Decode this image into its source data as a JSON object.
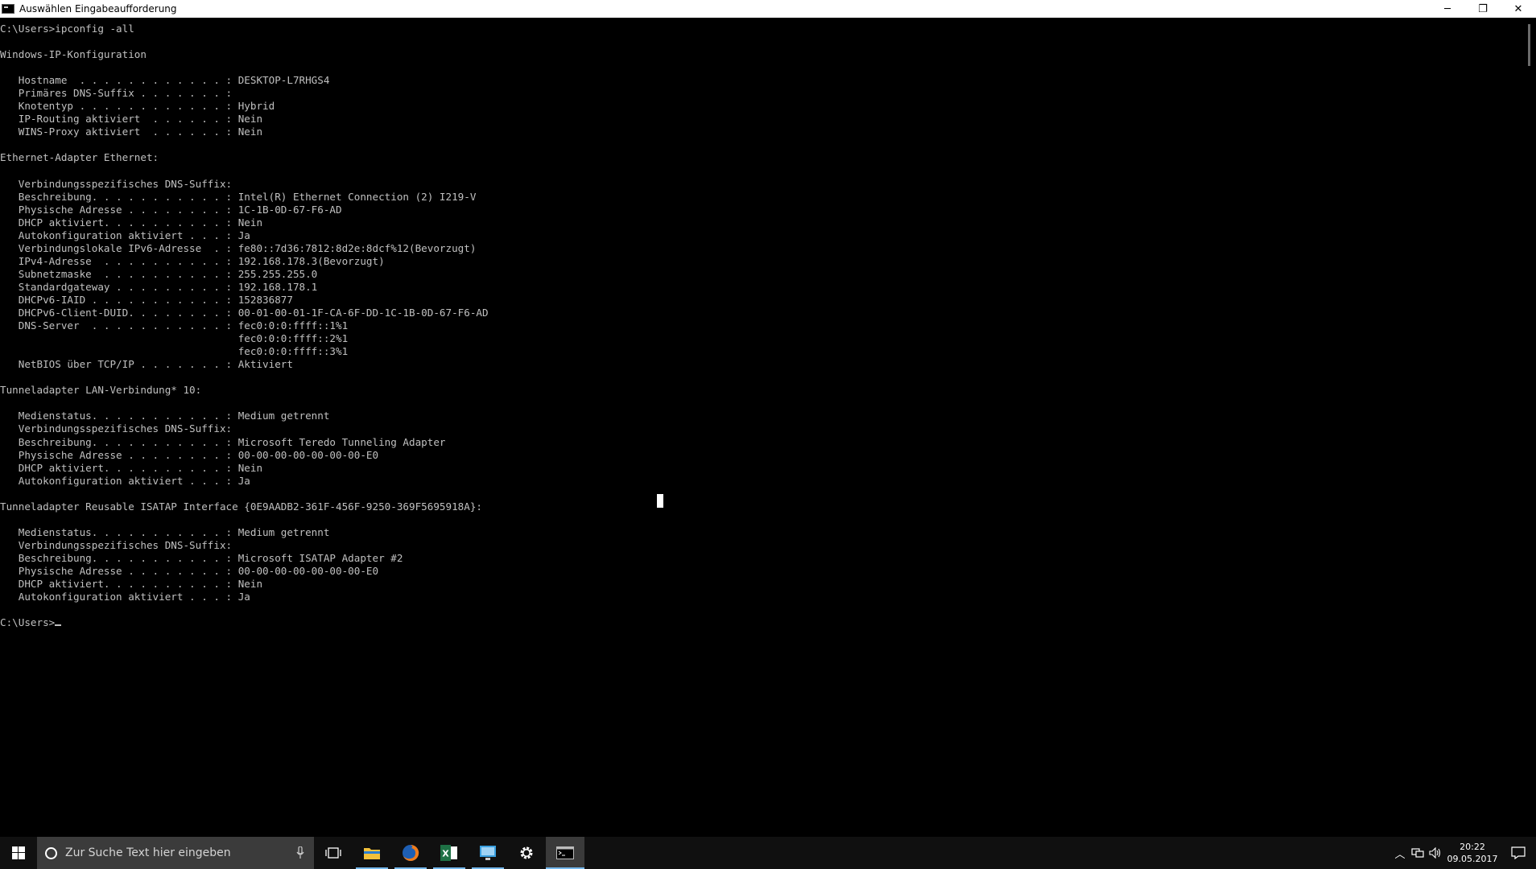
{
  "window": {
    "title": "Auswählen Eingabeaufforderung",
    "controls": {
      "minimize": "─",
      "restore": "❐",
      "close": "✕"
    }
  },
  "console": {
    "text": "C:\\Users>ipconfig -all\n\nWindows-IP-Konfiguration\n\n   Hostname  . . . . . . . . . . . . : DESKTOP-L7RHGS4\n   Primäres DNS-Suffix . . . . . . . :\n   Knotentyp . . . . . . . . . . . . : Hybrid\n   IP-Routing aktiviert  . . . . . . : Nein\n   WINS-Proxy aktiviert  . . . . . . : Nein\n\nEthernet-Adapter Ethernet:\n\n   Verbindungsspezifisches DNS-Suffix:\n   Beschreibung. . . . . . . . . . . : Intel(R) Ethernet Connection (2) I219-V\n   Physische Adresse . . . . . . . . : 1C-1B-0D-67-F6-AD\n   DHCP aktiviert. . . . . . . . . . : Nein\n   Autokonfiguration aktiviert . . . : Ja\n   Verbindungslokale IPv6-Adresse  . : fe80::7d36:7812:8d2e:8dcf%12(Bevorzugt)\n   IPv4-Adresse  . . . . . . . . . . : 192.168.178.3(Bevorzugt)\n   Subnetzmaske  . . . . . . . . . . : 255.255.255.0\n   Standardgateway . . . . . . . . . : 192.168.178.1\n   DHCPv6-IAID . . . . . . . . . . . : 152836877\n   DHCPv6-Client-DUID. . . . . . . . : 00-01-00-01-1F-CA-6F-DD-1C-1B-0D-67-F6-AD\n   DNS-Server  . . . . . . . . . . . : fec0:0:0:ffff::1%1\n                                       fec0:0:0:ffff::2%1\n                                       fec0:0:0:ffff::3%1\n   NetBIOS über TCP/IP . . . . . . . : Aktiviert\n\nTunneladapter LAN-Verbindung* 10:\n\n   Medienstatus. . . . . . . . . . . : Medium getrennt\n   Verbindungsspezifisches DNS-Suffix:\n   Beschreibung. . . . . . . . . . . : Microsoft Teredo Tunneling Adapter\n   Physische Adresse . . . . . . . . : 00-00-00-00-00-00-00-E0\n   DHCP aktiviert. . . . . . . . . . : Nein\n   Autokonfiguration aktiviert . . . : Ja\n\nTunneladapter Reusable ISATAP Interface {0E9AADB2-361F-456F-9250-369F5695918A}:\n\n   Medienstatus. . . . . . . . . . . : Medium getrennt\n   Verbindungsspezifisches DNS-Suffix:\n   Beschreibung. . . . . . . . . . . : Microsoft ISATAP Adapter #2\n   Physische Adresse . . . . . . . . : 00-00-00-00-00-00-00-E0\n   DHCP aktiviert. . . . . . . . . . : Nein\n   Autokonfiguration aktiviert . . . : Ja\n\n",
    "prompt": "C:\\Users>"
  },
  "taskbar": {
    "search_placeholder": "Zur Suche Text hier eingeben",
    "apps": [
      "task-view",
      "file-explorer",
      "firefox",
      "excel",
      "remote-desktop",
      "settings",
      "command-prompt"
    ],
    "active_app": "command-prompt",
    "clock": {
      "time": "20:22",
      "date": "09.05.2017"
    }
  },
  "colors": {
    "console_bg": "#000000",
    "console_fg": "#c0c0c0",
    "taskbar_bg": "#101010",
    "accent": "#76b9ed"
  }
}
